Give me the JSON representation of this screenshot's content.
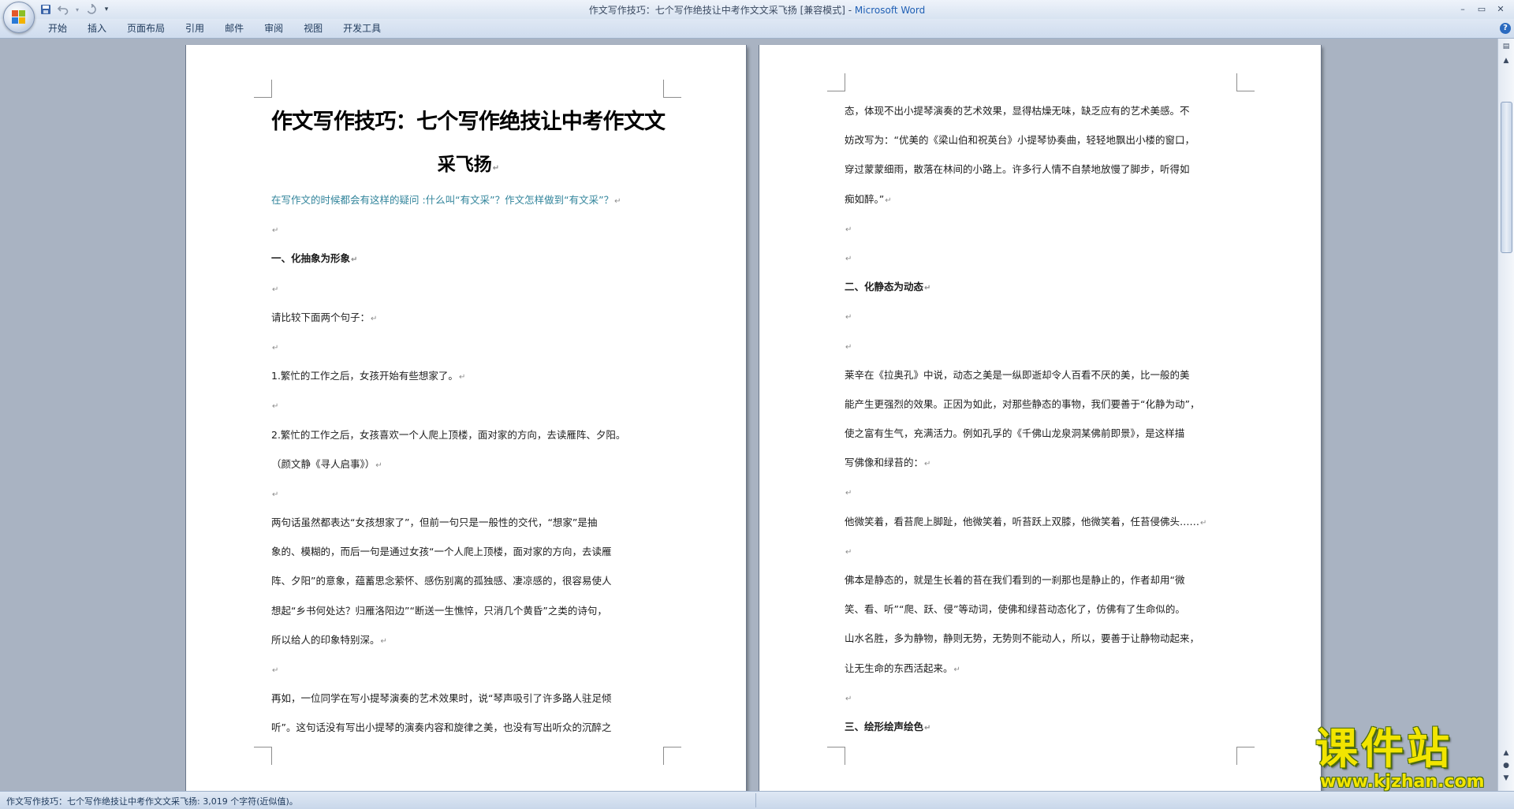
{
  "window": {
    "title_prefix": "作文写作技巧：七个写作绝技让中考作文文采飞扬 [兼容模式] - ",
    "app_name": "Microsoft Word",
    "minimize": "–",
    "restore": "▭",
    "close": "✕"
  },
  "quick_access": {
    "save_icon": "save-icon",
    "undo_icon": "undo-icon",
    "redo_icon": "redo-icon",
    "customize_icon": "customize-icon"
  },
  "ribbon": {
    "tabs": [
      "开始",
      "插入",
      "页面布局",
      "引用",
      "邮件",
      "审阅",
      "视图",
      "开发工具"
    ],
    "help": "?"
  },
  "document": {
    "page1": {
      "title_line1": "作文写作技巧：七个写作绝技让中考作文文",
      "title_line2": "采飞扬",
      "lines": [
        "在写作文的时候都会有这样的疑问 :什么叫“有文采”？作文怎样做到“有文采”？",
        "",
        "一、化抽象为形象",
        "",
        "请比较下面两个句子：",
        "",
        "1.繁忙的工作之后，女孩开始有些想家了。",
        "",
        "2.繁忙的工作之后，女孩喜欢一个人爬上顶楼，面对家的方向，去读雁阵、夕阳。",
        "（颜文静《寻人启事》）",
        "",
        "两句话虽然都表达“女孩想家了”，但前一句只是一般性的交代，“想家”是抽",
        "象的、模糊的，而后一句是通过女孩“一个人爬上顶楼，面对家的方向，去读雁",
        "阵、夕阳”的意象，蕴蓄思念萦怀、感伤别离的孤独感、凄凉感的，很容易使人",
        "想起“乡书何处达？归雁洛阳边”“断送一生憔悴，只消几个黄昏”之类的诗句，",
        "所以给人的印象特别深。",
        "",
        "再如，一位同学在写小提琴演奏的艺术效果时，说“琴声吸引了许多路人驻足倾",
        "听”。这句话没有写出小提琴的演奏内容和旋律之美，也没有写出听众的沉醉之"
      ]
    },
    "page2": {
      "lines": [
        "态，体现不出小提琴演奏的艺术效果，显得枯燥无味，缺乏应有的艺术美感。不",
        "妨改写为：“优美的《梁山伯和祝英台》小提琴协奏曲，轻轻地飘出小楼的窗口，",
        "穿过蒙蒙细雨，散落在林间的小路上。许多行人情不自禁地放慢了脚步，听得如",
        "痴如醉。”",
        "",
        "",
        "二、化静态为动态",
        "",
        "",
        "莱辛在《拉奥孔》中说，动态之美是一纵即逝却令人百看不厌的美，比一般的美",
        "能产生更强烈的效果。正因为如此，对那些静态的事物，我们要善于“化静为动”，",
        "使之富有生气，充满活力。例如孔孚的《千佛山龙泉洞某佛前即景》，是这样描",
        "写佛像和绿苔的：",
        "",
        "他微笑着，看苔爬上脚趾，他微笑着，听苔跃上双膝，他微笑着，任苔侵佛头……",
        "",
        "佛本是静态的，就是生长着的苔在我们看到的一刹那也是静止的，作者却用“微",
        "笑、看、听”“爬、跃、侵”等动词，使佛和绿苔动态化了，仿佛有了生命似的。",
        "山水名胜，多为静物，静则无势，无势则不能动人，所以，要善于让静物动起来，",
        "让无生命的东西活起来。",
        "",
        "三、绘形绘声绘色"
      ]
    },
    "paragraph_mark": "↵"
  },
  "statusbar": {
    "text": "作文写作技巧：七个写作绝技让中考作文文采飞扬: 3,019 个字符(近似值)。"
  },
  "watermark": {
    "main": "课件站",
    "url": "www.kjzhan.com"
  },
  "colors": {
    "subtitle": "#31849b",
    "app_name": "#1f5fb4",
    "watermark": "#f2e500",
    "workspace": "#a9b3c2"
  }
}
